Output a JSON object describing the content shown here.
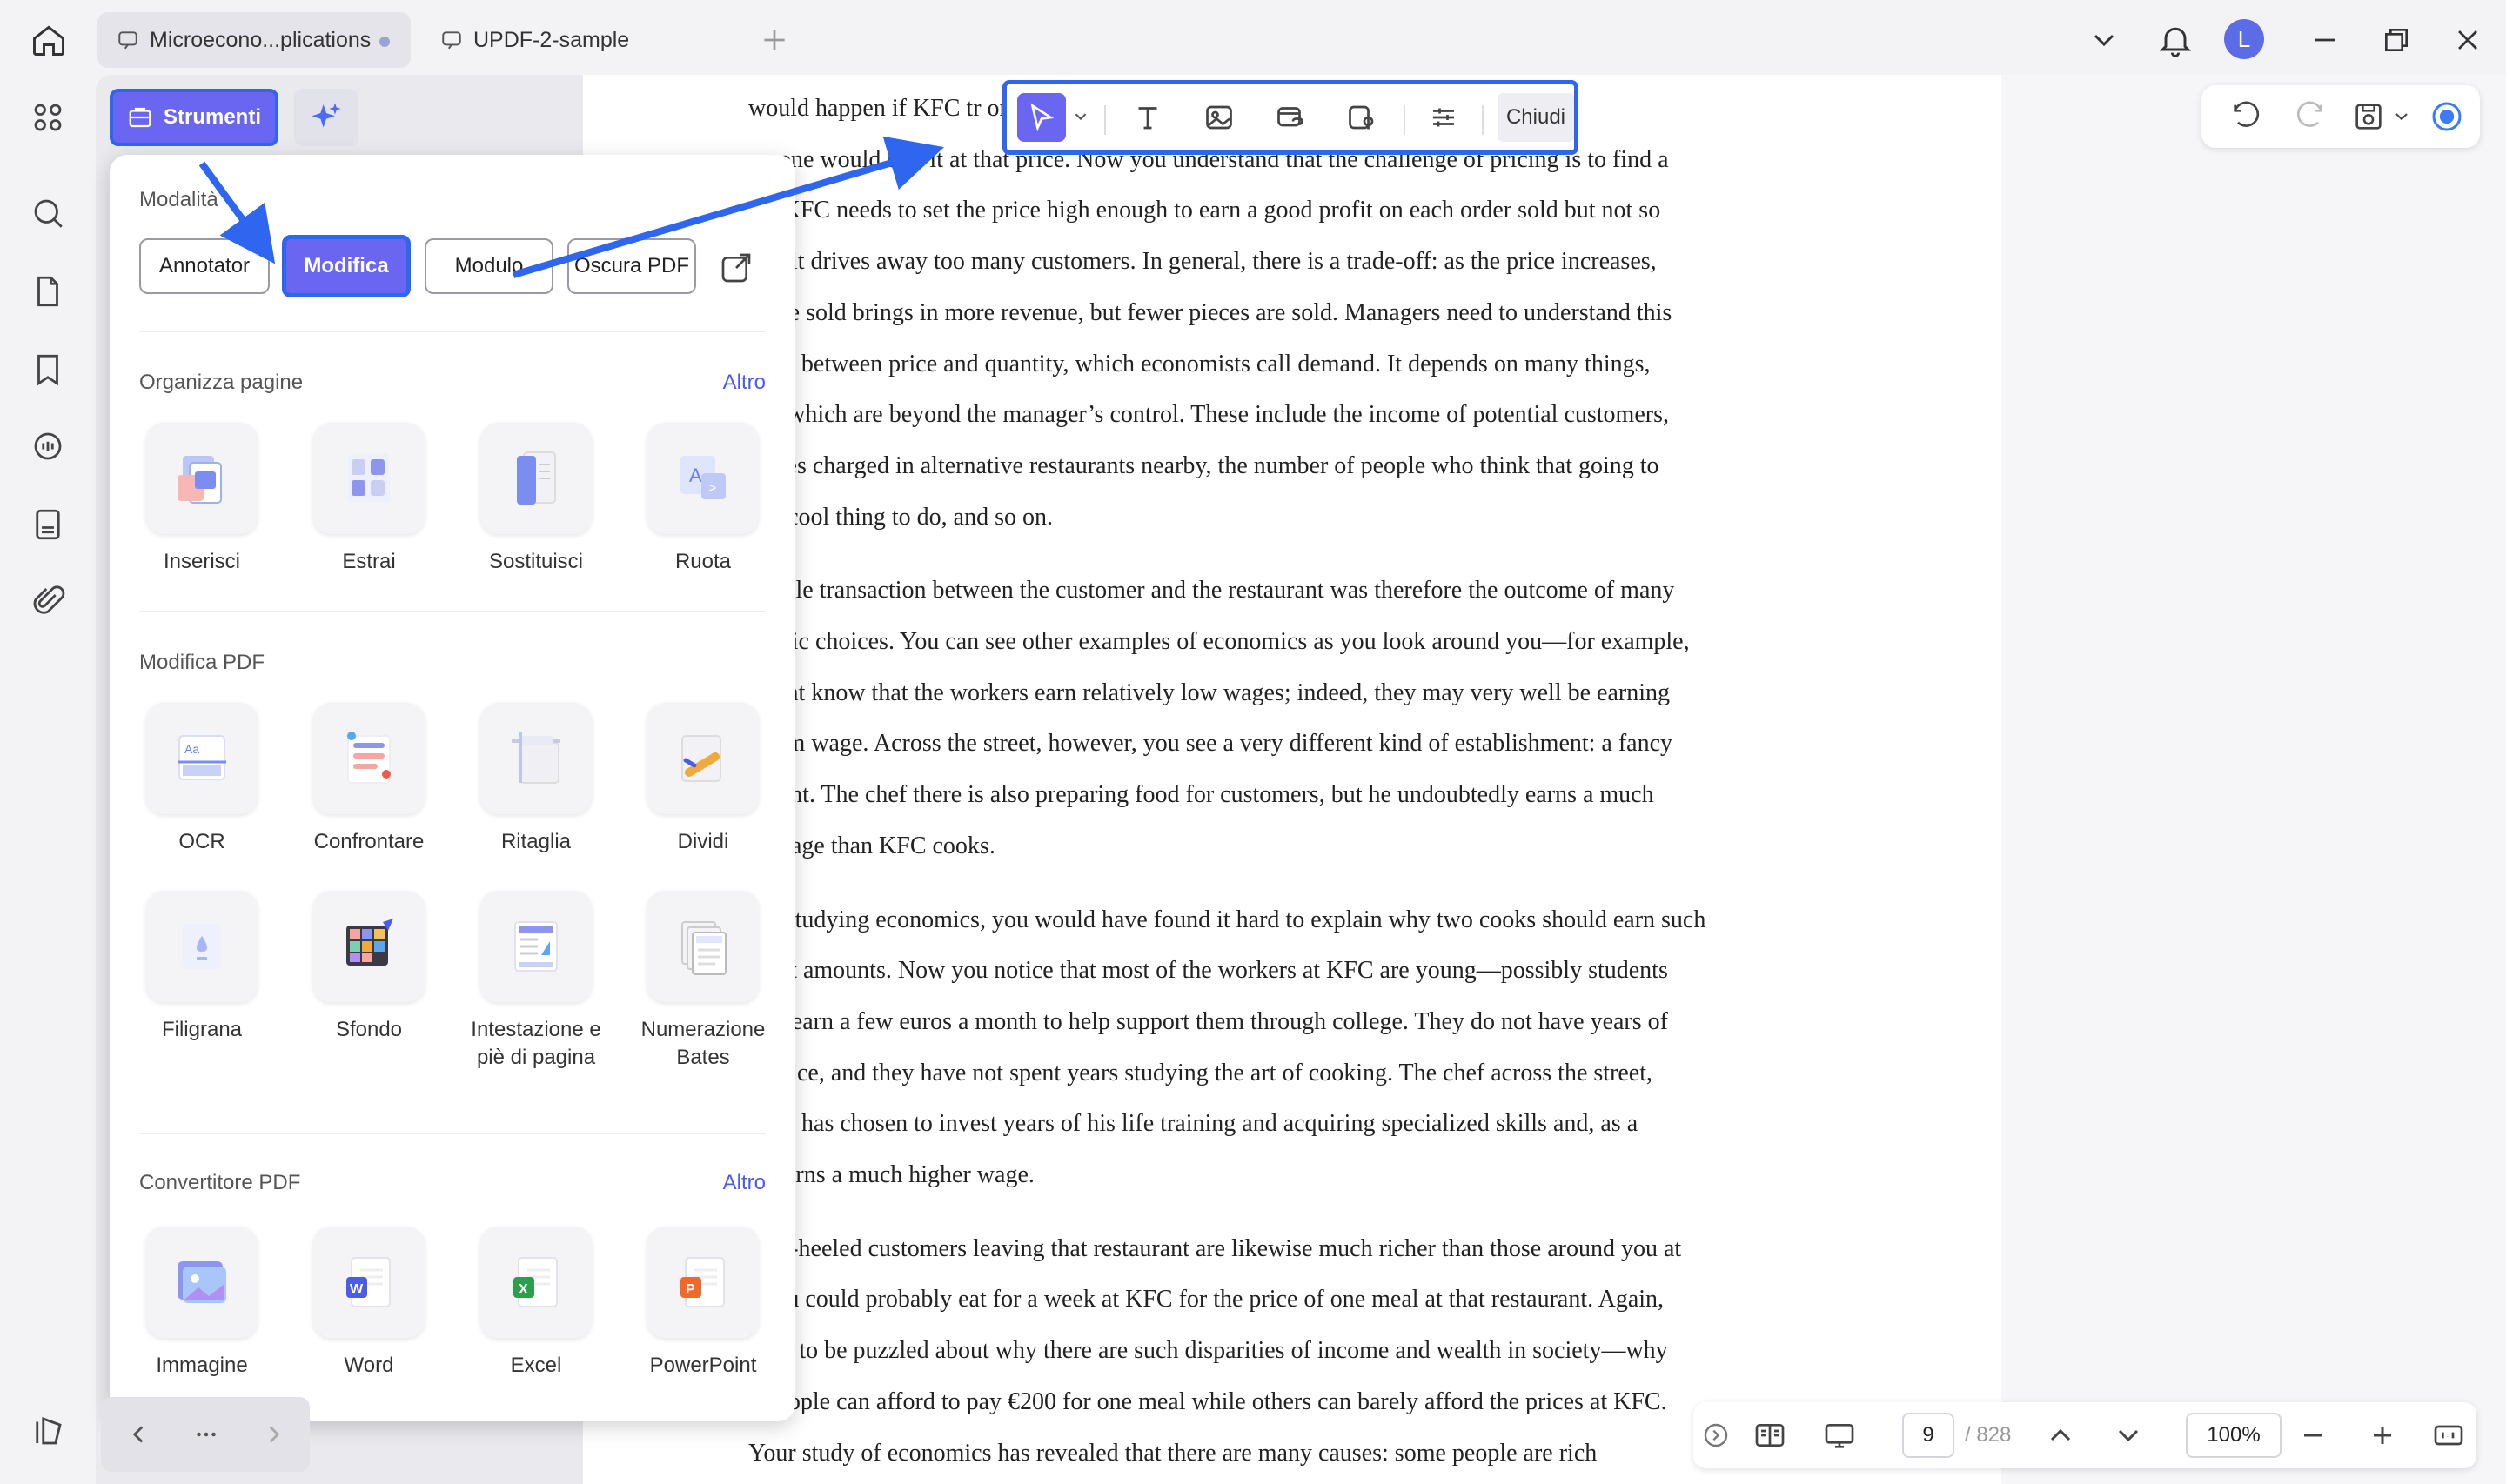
{
  "tabs": [
    {
      "label": "Microecono...plications",
      "active": true,
      "unsaved": true
    },
    {
      "label": "UPDF-2-sample",
      "active": false
    }
  ],
  "user": {
    "avatar_letter": "L"
  },
  "toolbar_top": {
    "strumenti_label": "Strumenti",
    "ai_label": "AI"
  },
  "edit_toolbar": {
    "close_label": "Chiudi"
  },
  "panel": {
    "modalita": {
      "title": "Modalità",
      "buttons": [
        "Annotator",
        "Modifica",
        "Modulo",
        "Oscura PDF"
      ]
    },
    "organizza": {
      "title": "Organizza pagine",
      "more": "Altro",
      "tools": [
        "Inserisci",
        "Estrai",
        "Sostituisci",
        "Ruota"
      ]
    },
    "modifica": {
      "title": "Modifica PDF",
      "tools": [
        "OCR",
        "Confrontare",
        "Ritaglia",
        "Dividi",
        "Filigrana",
        "Sfondo",
        "Intestazione e piè di pagina",
        "Numerazione Bates"
      ]
    },
    "convertitore": {
      "title": "Convertitore PDF",
      "more": "Altro",
      "tools": [
        "Immagine",
        "Word",
        "Excel",
        "PowerPoint"
      ]
    }
  },
  "document": {
    "paragraphs": [
      [
        "would happen if KFC tr                                              on sense tells you that",
        "no one would buy it at that price. Now you understand that the challenge of pricing is to find a",
        "    ce: KFC needs to set the price high enough to earn a good profit on each order sold but not so",
        "    that it drives away too many customers. In general, there is a trade-off: as the price increases,",
        "    piece sold brings in more revenue, but fewer pieces are sold. Managers need to understand this",
        "    e-off between price and quantity, which economists call demand. It depends on many things,",
        "    t of which are beyond the manager’s control. These include the income of potential customers,",
        "    prices charged in alternative restaurants nearby, the number of people who think that going to",
        "    is a cool thing to do, and so on."
      ],
      [
        "    simple transaction between the customer and the restaurant was therefore the outcome of many",
        "    nomic choices. You can see other examples of economics as you look around you—for example,",
        "    might know that the workers earn relatively low wages; indeed, they may very well be earning",
        "    imum wage. Across the street, however, you see a very different kind of establishment: a fancy",
        "    aurant. The chef there is also preparing food for customers, but he undoubtedly earns a much",
        "    er wage than KFC cooks."
      ],
      [
        "    ore studying economics, you would have found it hard to explain why two cooks should earn such",
        "    erent amounts. Now you notice that most of the workers at KFC are young—possibly students",
        "    g to earn a few euros a month to help support them through college. They do not have years of",
        "    erience, and they have not spent years studying the art of cooking. The chef across the street,",
        "    ever, has chosen to invest years of his life training and acquiring specialized skills and, as a",
        "    lt, earns a much higher wage."
      ],
      [
        "    well-heeled customers leaving that restaurant are likewise much richer than those around you at",
        "    . You could probably eat for a week at KFC for the price of one meal at that restaurant. Again,",
        "    used to be puzzled about why there are such disparities of income and wealth in society—why",
        "    e people can afford to pay €200 for one meal while others can barely afford the prices at KFC.",
        "Your study of economics has revealed that there are many causes: some people are rich"
      ]
    ]
  },
  "pagebar": {
    "current_page": "9",
    "total_pages": "/ 828",
    "zoom": "100%"
  },
  "colors": {
    "accent": "#6a66f2",
    "highlight_border": "#2f66f0",
    "link": "#4a5ce8"
  }
}
